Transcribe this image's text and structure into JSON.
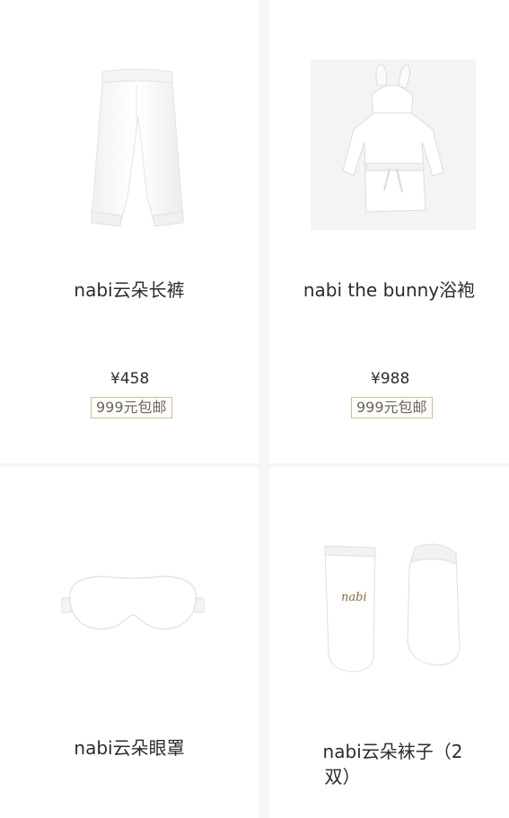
{
  "products": [
    {
      "name": "nabi云朵长裤",
      "price": "¥458",
      "badge": "999元包邮",
      "icon": "pants-icon"
    },
    {
      "name": "nabi the bunny浴袍",
      "price": "¥988",
      "badge": "999元包邮",
      "icon": "bathrobe-icon"
    },
    {
      "name": "nabi云朵眼罩",
      "icon": "eye-mask-icon"
    },
    {
      "name_line1": "nabi云朵袜子（2",
      "name_line2": "双）",
      "icon": "socks-icon",
      "logo_text": "nabi"
    }
  ]
}
